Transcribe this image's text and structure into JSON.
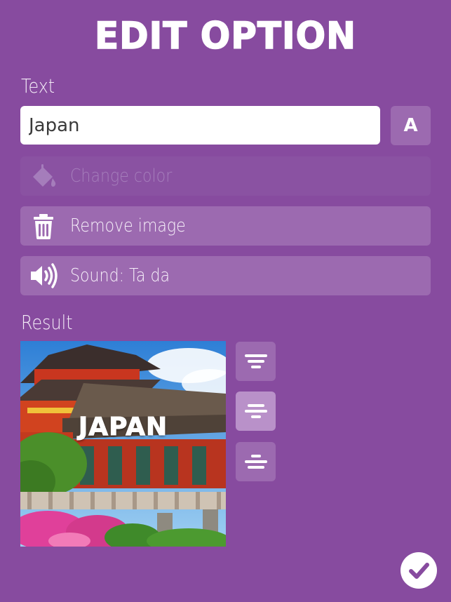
{
  "header": {
    "title": "EDIT OPTION"
  },
  "text_section": {
    "label": "Text",
    "input_value": "Japan",
    "font_button_label": "A"
  },
  "actions": [
    {
      "label": "Change color",
      "icon": "paint-bucket-icon",
      "enabled": false
    },
    {
      "label": "Remove image",
      "icon": "trash-icon",
      "enabled": true
    },
    {
      "label": "Sound: Ta da",
      "icon": "speaker-icon",
      "enabled": true
    }
  ],
  "result_section": {
    "label": "Result",
    "caption": "JAPAN",
    "alignment_options": [
      {
        "name": "align-top",
        "selected": false
      },
      {
        "name": "align-middle",
        "selected": true
      },
      {
        "name": "align-bottom",
        "selected": false
      }
    ]
  },
  "colors": {
    "background": "#874b9f",
    "button": "#9c6ab0",
    "button_selected": "#b991c9",
    "confirm_check": "#874b9f"
  }
}
